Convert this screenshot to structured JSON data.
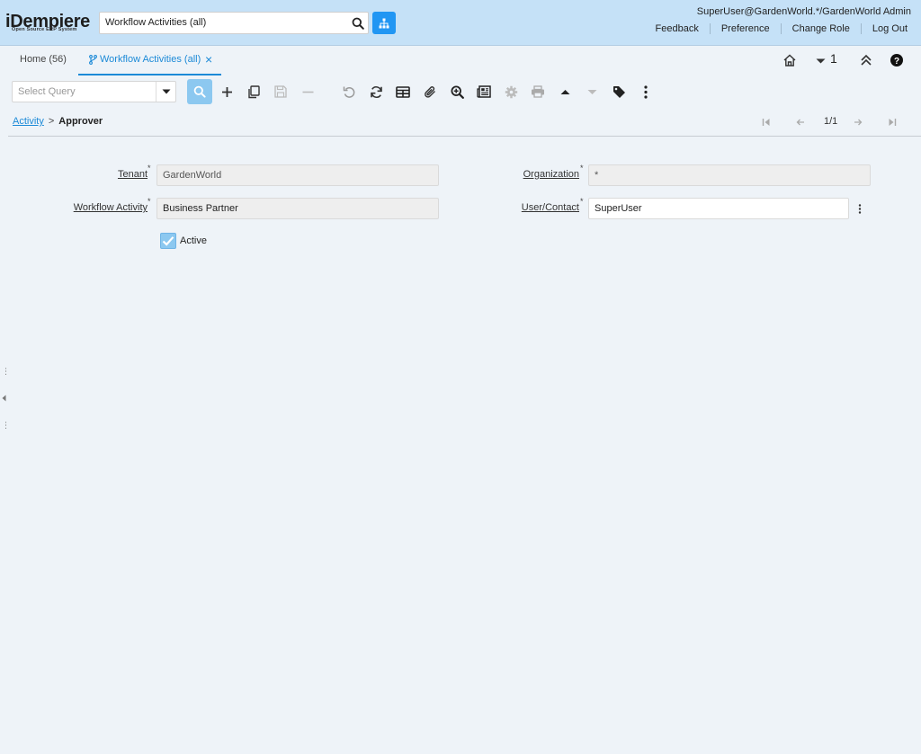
{
  "header": {
    "logo_main": "iDempiere",
    "logo_sub": "Open Source ERP System",
    "search_value": "Workflow Activities (all)",
    "user": "SuperUser@GardenWorld.*/GardenWorld Admin",
    "links": [
      "Feedback",
      "Preference",
      "Change Role",
      "Log Out"
    ]
  },
  "tabs": {
    "home": "Home (56)",
    "active": "Workflow Activities (all)",
    "window_count": "1"
  },
  "toolbar": {
    "query_placeholder": "Select Query"
  },
  "breadcrumb": {
    "parent": "Activity",
    "separator": ">",
    "current": "Approver",
    "record": "1/1"
  },
  "form": {
    "tenant_label": "Tenant",
    "tenant_value": "GardenWorld",
    "organization_label": "Organization",
    "organization_value": "*",
    "workflow_activity_label": "Workflow Activity",
    "workflow_activity_value": "Business Partner",
    "user_contact_label": "User/Contact",
    "user_contact_value": "SuperUser",
    "active_label": "Active",
    "active_checked": true
  },
  "colors": {
    "header_bg": "#c5e1f7",
    "accent": "#1c8ad7",
    "tree_button": "#2196f3",
    "find_button": "#8cc8f0",
    "page_bg": "#eef3f8"
  }
}
